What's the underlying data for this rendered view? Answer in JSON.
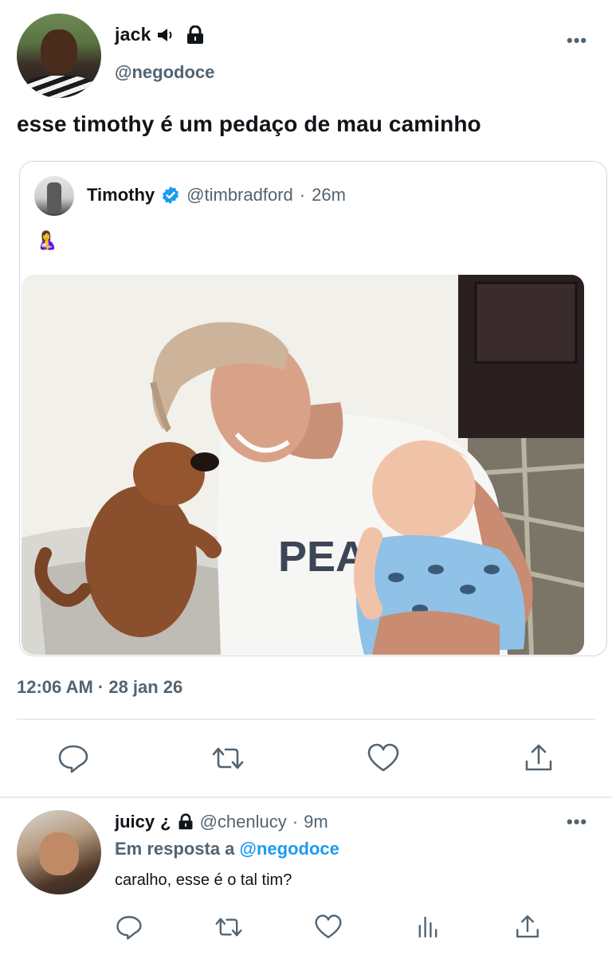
{
  "main_tweet": {
    "display_name": "jack",
    "name_emojis": [
      "speaker-icon",
      "lock-icon"
    ],
    "handle": "@negodoce",
    "text": "esse timothy é um pedaço de mau caminho",
    "timestamp": "12:06 AM · 28 jan 26",
    "actions": [
      "reply-icon",
      "retweet-icon",
      "like-icon",
      "share-icon"
    ]
  },
  "quoted_tweet": {
    "display_name": "Timothy",
    "handle": "@timbradford",
    "separator": "·",
    "age": "26m",
    "emoji": "🤱"
  },
  "reply": {
    "display_name": "juicy",
    "name_suffix": "¿",
    "handle": "@chenlucy",
    "separator": "·",
    "age": "9m",
    "in_reply_prefix": "Em resposta a",
    "in_reply_mention": "@negodoce",
    "text": "caralho, esse é o tal tim?",
    "actions": [
      "reply-icon",
      "retweet-icon",
      "like-icon",
      "analytics-icon",
      "share-icon"
    ]
  },
  "colors": {
    "text": "#0f1419",
    "secondary": "#536471",
    "accent": "#1d9bf0",
    "border": "#cfd9de"
  }
}
